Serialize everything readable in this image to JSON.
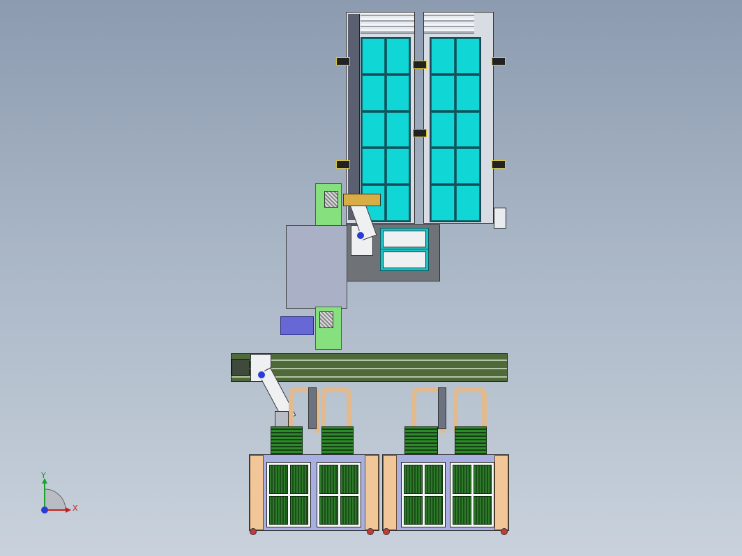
{
  "triad": {
    "y_label": "Y",
    "x_label": "X"
  },
  "colors": {
    "tray_cell": "#11d6d6",
    "feeder": "#86e07e",
    "conveyor": "#4f6a3a",
    "frame": "#a7b0e0",
    "pillar": "#f1c79a",
    "joint": "#2a3cd6"
  }
}
